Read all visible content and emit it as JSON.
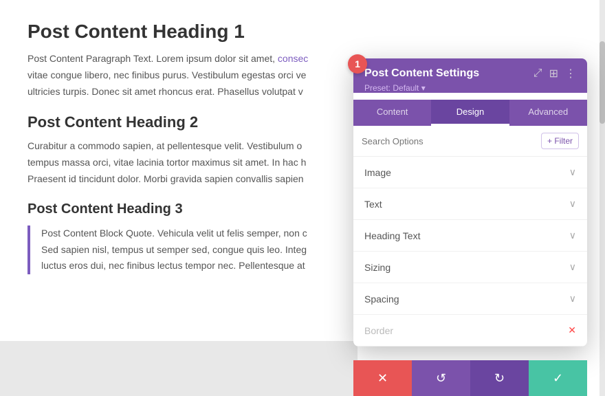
{
  "page": {
    "background_color": "#ffffff"
  },
  "content": {
    "heading1": "Post Content Heading 1",
    "paragraph1": "Post Content Paragraph Text. Lorem ipsum dolor sit amet, consec vitae congue libero, nec finibus purus. Vestibulum egestas orci ve ultricies turpis. Donec sit amet rhoncus erat. Phasellus volutpat v",
    "link_text": "consec",
    "heading2": "Post Content Heading 2",
    "paragraph2": "Curabitur a commodo sapien, at pellentesque velit. Vestibulum o tempus massa orci, vitae lacinia tortor maximus sit amet. In hac h Praesent id tincidunt dolor. Morbi gravida sapien convallis sapien",
    "heading3": "Post Content Heading 3",
    "blockquote": "Post Content Block Quote. Vehicula velit ut felis semper, non c Sed sapien nisl, tempus ut semper sed, congue quis leo. Integ luctus eros dui, nec finibus lectus tempor nec. Pellentesque at"
  },
  "panel": {
    "title": "Post Content Settings",
    "preset_label": "Preset: Default",
    "preset_arrow": "▾",
    "badge_number": "1",
    "tabs": [
      {
        "id": "content",
        "label": "Content"
      },
      {
        "id": "design",
        "label": "Design",
        "active": true
      },
      {
        "id": "advanced",
        "label": "Advanced"
      }
    ],
    "search_placeholder": "Search Options",
    "filter_label": "+ Filter",
    "sections": [
      {
        "id": "image",
        "label": "Image",
        "chevron": "∨",
        "disabled": false
      },
      {
        "id": "text",
        "label": "Text",
        "chevron": "∨",
        "disabled": false
      },
      {
        "id": "heading-text",
        "label": "Heading Text",
        "chevron": "∨",
        "disabled": false
      },
      {
        "id": "sizing",
        "label": "Sizing",
        "chevron": "∨",
        "disabled": false
      },
      {
        "id": "spacing",
        "label": "Spacing",
        "chevron": "∨",
        "disabled": false
      },
      {
        "id": "border",
        "label": "Border",
        "chevron": "✕",
        "disabled": true
      }
    ],
    "actions": {
      "cancel": "✕",
      "undo": "↺",
      "redo": "↻",
      "save": "✓"
    },
    "icons": {
      "resize": "⤢",
      "columns": "⊞",
      "more": "⋮"
    }
  }
}
